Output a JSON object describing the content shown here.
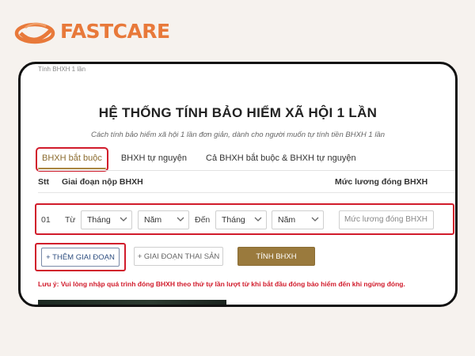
{
  "brand": {
    "name": "FASTCARE",
    "color": "#e8793a"
  },
  "breadcrumb": "Tính BHXH 1 lần",
  "page": {
    "title": "HỆ THỐNG TÍNH BẢO HIỂM XÃ HỘI 1 LẦN",
    "subtitle": "Cách tính bảo hiểm xã hội 1 lần đơn giản, dành cho người muốn tự tính tiền BHXH 1 lần"
  },
  "tabs": [
    {
      "label": "BHXH bắt buộc",
      "active": true
    },
    {
      "label": "BHXH tự nguyện",
      "active": false
    },
    {
      "label": "Cả BHXH bắt buộc & BHXH tự nguyện",
      "active": false
    }
  ],
  "table": {
    "headers": {
      "stt": "Stt",
      "period": "Giai đoạn nộp BHXH",
      "salary": "Mức lương đóng BHXH"
    },
    "row": {
      "num": "01",
      "from_label": "Từ",
      "to_label": "Đến",
      "month_from": "Tháng",
      "year_from": "Năm",
      "month_to": "Tháng",
      "year_to": "Năm",
      "salary_placeholder": "Mức lương đóng BHXH"
    }
  },
  "buttons": {
    "add_period": "+ THÊM GIAI ĐOẠN",
    "maternity": "+ GIAI ĐOẠN THAI SẢN",
    "calculate": "TÍNH BHXH"
  },
  "note": "Lưu ý: Vui lòng nhập quá trình đóng BHXH theo thứ tự lần lượt từ khi bắt đầu đóng bảo hiểm đến khi ngừng đóng.",
  "colors": {
    "accent": "#9a7a3d",
    "highlight": "#d11b2b"
  }
}
